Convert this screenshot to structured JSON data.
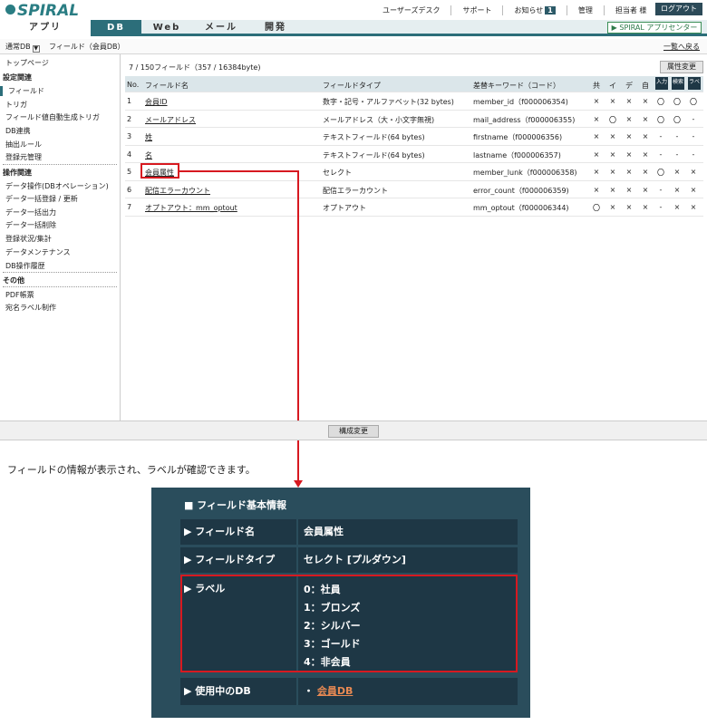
{
  "header": {
    "logo_text": "SPIRAL",
    "nav": [
      "ユーザーズデスク",
      "サポート",
      "お知らせ",
      "管理",
      "担当者 様"
    ],
    "notice_count": "1",
    "logout_label": "ログアウト"
  },
  "tabs": [
    {
      "label": "アプリ",
      "active": false
    },
    {
      "label": "DB",
      "active": true
    },
    {
      "label": "Web",
      "active": false
    },
    {
      "label": "メール",
      "active": false
    },
    {
      "label": "開発",
      "active": false
    }
  ],
  "app_center_label": "SPIRAL アプリセンター",
  "breadcrumb": {
    "db_selector": "通常DB",
    "path": "フィールド（会員DB）",
    "back_link": "一覧へ戻る"
  },
  "sidebar": {
    "top": "トップページ",
    "sections": [
      {
        "heading": "設定関連",
        "items": [
          "フィールド",
          "トリガ",
          "フィールド値自動生成トリガ",
          "DB連携",
          "抽出ルール",
          "登録元管理"
        ]
      },
      {
        "heading": "操作関連",
        "items": [
          "データ操作(DBオペレーション)",
          "データ一括登録 / 更新",
          "データ一括出力",
          "データ一括削除",
          "登録状況/集計",
          "データメンテナンス",
          "DB操作履歴"
        ]
      },
      {
        "heading": "その他",
        "items": [
          "PDF帳票",
          "宛名ラベル制作"
        ]
      }
    ],
    "selected": "フィールド"
  },
  "main": {
    "count_text": "7 / 150フィールド（357 / 16384byte)",
    "attr_button": "属性変更",
    "columns": [
      "No.",
      "フィールド名",
      "フィールドタイプ",
      "差替キーワード（コード）",
      "共",
      "イ",
      "デ",
      "自",
      "入力",
      "検索",
      "ラベ"
    ],
    "rows": [
      {
        "no": "1",
        "name": "会員ID",
        "type": "数字・記号・アルファベット(32 bytes)",
        "keyword": "member_id（f000006354)",
        "marks": [
          "×",
          "×",
          "×",
          "×",
          "〇",
          "〇",
          "〇"
        ]
      },
      {
        "no": "2",
        "name": "メールアドレス",
        "type": "メールアドレス（大・小文字無視)",
        "keyword": "mail_address（f000006355)",
        "marks": [
          "×",
          "〇",
          "×",
          "×",
          "〇",
          "〇",
          "-"
        ]
      },
      {
        "no": "3",
        "name": "姓",
        "type": "テキストフィールド(64 bytes)",
        "keyword": "firstname（f000006356)",
        "marks": [
          "×",
          "×",
          "×",
          "×",
          "-",
          "-",
          "-"
        ]
      },
      {
        "no": "4",
        "name": "名",
        "type": "テキストフィールド(64 bytes)",
        "keyword": "lastname（f000006357)",
        "marks": [
          "×",
          "×",
          "×",
          "×",
          "-",
          "-",
          "-"
        ]
      },
      {
        "no": "5",
        "name": "会員属性",
        "type": "セレクト",
        "keyword": "member_lunk（f000006358)",
        "marks": [
          "×",
          "×",
          "×",
          "×",
          "〇",
          "×",
          "×"
        ]
      },
      {
        "no": "6",
        "name": "配信エラーカウント",
        "type": "配信エラーカウント",
        "keyword": "error_count（f000006359)",
        "marks": [
          "×",
          "×",
          "×",
          "×",
          "-",
          "×",
          "×"
        ]
      },
      {
        "no": "7",
        "name": "オプトアウト：mm_optout",
        "type": "オプトアウト",
        "keyword": "mm_optout（f000006344)",
        "marks": [
          "〇",
          "×",
          "×",
          "×",
          "-",
          "×",
          "×"
        ]
      }
    ],
    "config_button": "構成変更"
  },
  "caption": "フィールドの情報が表示され、ラベルが確認できます。",
  "panel": {
    "title": "■ フィールド基本情報",
    "rows": [
      {
        "label": "▶ フィールド名",
        "value": "会員属性"
      },
      {
        "label": "▶ フィールドタイプ",
        "value": "セレクト [プルダウン]"
      },
      {
        "label": "▶ ラベル",
        "values": [
          "0：社員",
          "1：ブロンズ",
          "2：シルバー",
          "3：ゴールド",
          "4：非会員"
        ]
      },
      {
        "label": "▶ 使用中のDB",
        "bullet": "・",
        "link": "会員DB"
      }
    ]
  },
  "colors": {
    "accent": "#2c6e7a",
    "panel": "#2a4d5c",
    "highlight": "#d71920"
  }
}
